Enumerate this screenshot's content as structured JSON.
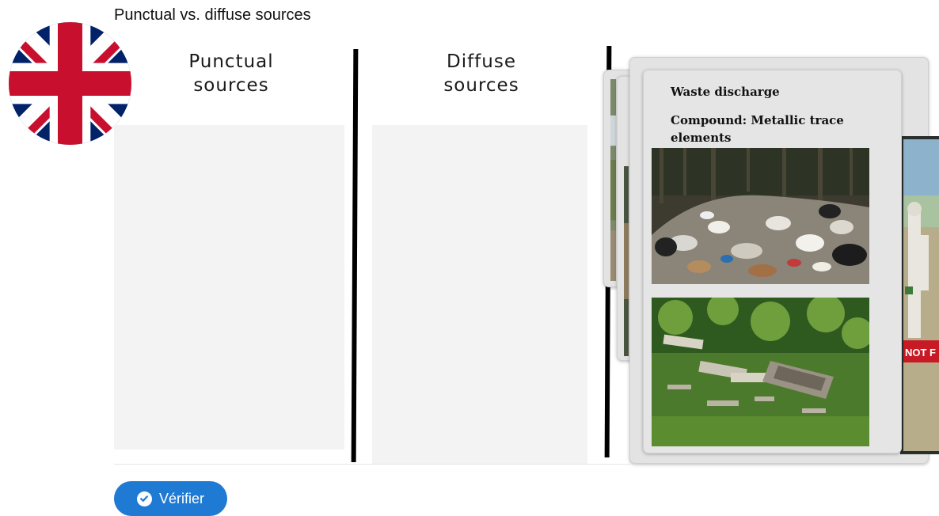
{
  "page": {
    "title": "Punctual vs. diffuse sources"
  },
  "language_flag": {
    "icon": "uk-flag-icon",
    "colors": {
      "blue": "#012169",
      "red": "#C8102E",
      "white": "#FFFFFF"
    }
  },
  "columns": [
    {
      "header_line1": "Punctual",
      "header_line2": "sources"
    },
    {
      "header_line1": "Diffuse",
      "header_line2": "sources"
    }
  ],
  "card": {
    "title": "Waste discharge",
    "compound_line1": "Compound: Metallic trace",
    "compound_line2": "elements",
    "back_card_sign_text": "NOT F"
  },
  "actions": {
    "verify_label": "Vérifier",
    "verify_icon": "check-circle-icon",
    "accent": "#1f7ad4"
  }
}
